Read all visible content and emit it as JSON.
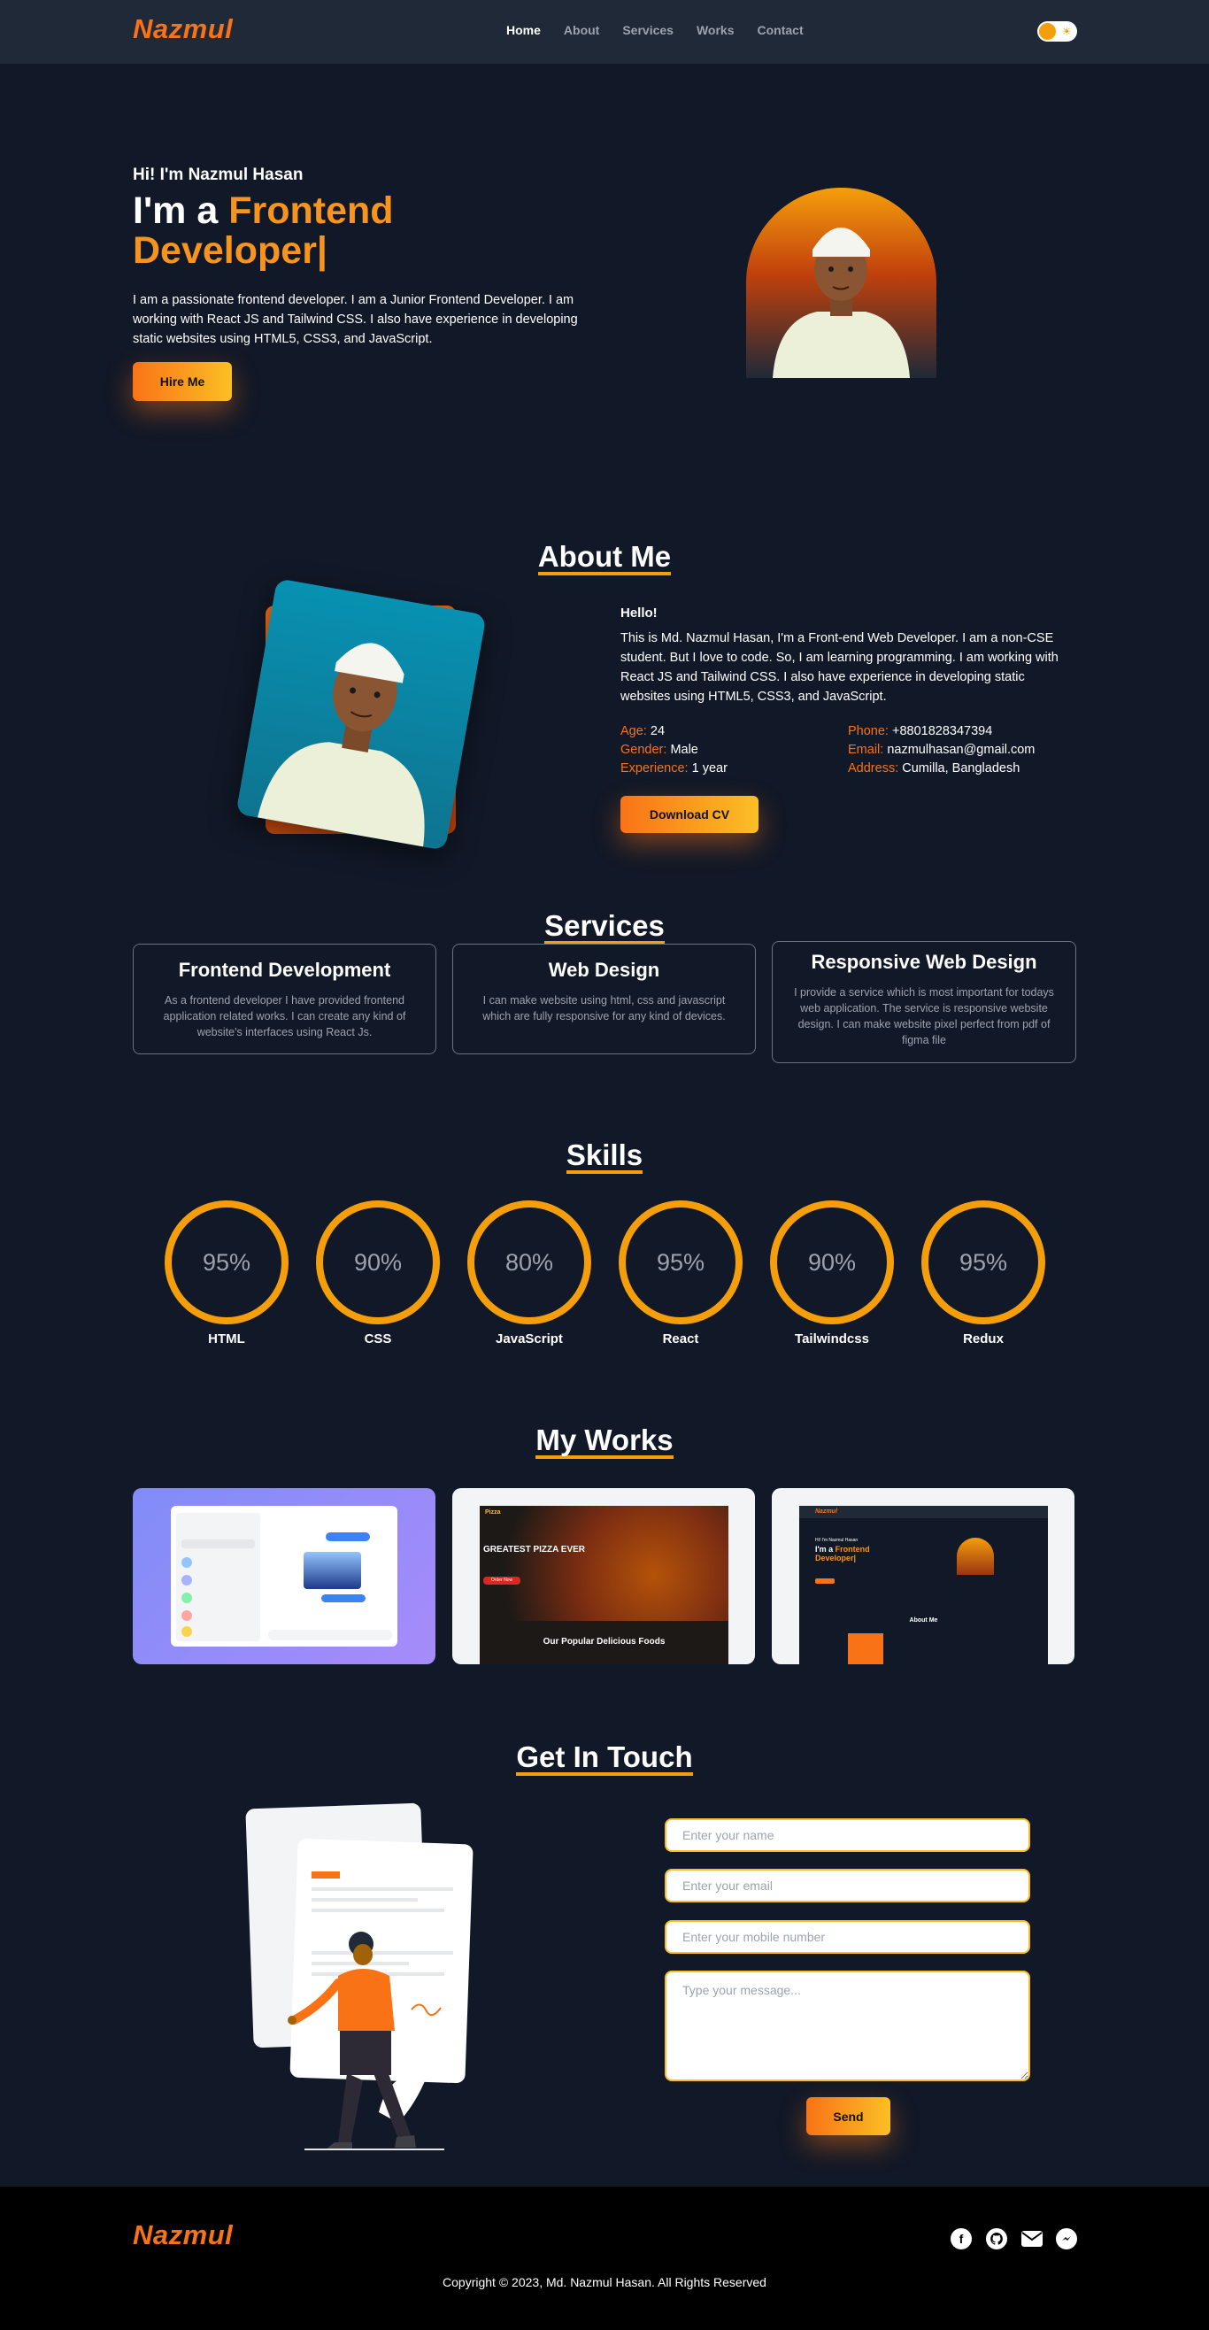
{
  "brand": "Nazmul",
  "nav": {
    "items": [
      "Home",
      "About",
      "Services",
      "Works",
      "Contact"
    ],
    "active": "Home"
  },
  "hero": {
    "greeting": "Hi! I'm Nazmul Hasan",
    "title_prefix": "I'm a",
    "title_highlight": "Frontend Developer|",
    "description": "I am a passionate frontend developer. I am a Junior Frontend Developer. I am working with React JS and Tailwind CSS. I also have experience in developing static websites using HTML5, CSS3, and JavaScript.",
    "cta": "Hire Me"
  },
  "about": {
    "title": "About Me",
    "hello": "Hello!",
    "text": "This is Md. Nazmul Hasan, I'm a Front-end Web Developer. I am a non-CSE student. But I love to code. So, I am learning programming. I am working with React JS and Tailwind CSS. I also have experience in developing static websites using HTML5, CSS3, and JavaScript.",
    "info_left": [
      {
        "key": "Age:",
        "value": "24"
      },
      {
        "key": "Gender:",
        "value": "Male"
      },
      {
        "key": "Experience:",
        "value": "1 year"
      }
    ],
    "info_right": [
      {
        "key": "Phone:",
        "value": "+8801828347394"
      },
      {
        "key": "Email:",
        "value": "nazmulhasan@gmail.com"
      },
      {
        "key": "Address:",
        "value": "Cumilla, Bangladesh"
      }
    ],
    "download": "Download CV"
  },
  "services": {
    "title": "Services",
    "items": [
      {
        "title": "Frontend Development",
        "desc": "As a frontend developer I have provided frontend application related works. I can create any kind of website's interfaces using React Js."
      },
      {
        "title": "Web Design",
        "desc": "I can make website using html, css and javascript which are fully responsive for any kind of devices."
      },
      {
        "title": "Responsive Web Design",
        "desc": "I provide a service which is most important for todays web application. The service is responsive website design. I can make website pixel perfect from pdf of figma file"
      }
    ]
  },
  "skills": {
    "title": "Skills",
    "items": [
      {
        "name": "HTML",
        "value": "95%"
      },
      {
        "name": "CSS",
        "value": "90%"
      },
      {
        "name": "JavaScript",
        "value": "80%"
      },
      {
        "name": "React",
        "value": "95%"
      },
      {
        "name": "Tailwindcss",
        "value": "90%"
      },
      {
        "name": "Redux",
        "value": "95%"
      }
    ]
  },
  "works": {
    "title": "My Works",
    "pizza": {
      "logo": "Pizza",
      "headline": "GREATEST PIZZA EVER",
      "button": "Order Now",
      "section": "Our Popular Delicious Foods"
    },
    "portfolio": {
      "logo": "Nazmul",
      "greet": "Hi! I'm Nazmul Hasan",
      "title_prefix": "I'm a",
      "title_highlight": "Frontend Developer|",
      "section": "About Me"
    }
  },
  "contact": {
    "title": "Get In Touch",
    "name_placeholder": "Enter your name",
    "email_placeholder": "Enter your email",
    "mobile_placeholder": "Enter your mobile number",
    "message_placeholder": "Type your message...",
    "send": "Send"
  },
  "footer": {
    "brand": "Nazmul",
    "social": [
      "facebook-icon",
      "github-icon",
      "mail-icon",
      "messenger-icon"
    ],
    "copyright": "Copyright © 2023, Md. Nazmul Hasan. All Rights Reserved"
  },
  "colors": {
    "bg": "#111827",
    "nav": "#1f2937",
    "accent": "#f97316",
    "accent2": "#fbbf24",
    "footer": "#000000"
  }
}
